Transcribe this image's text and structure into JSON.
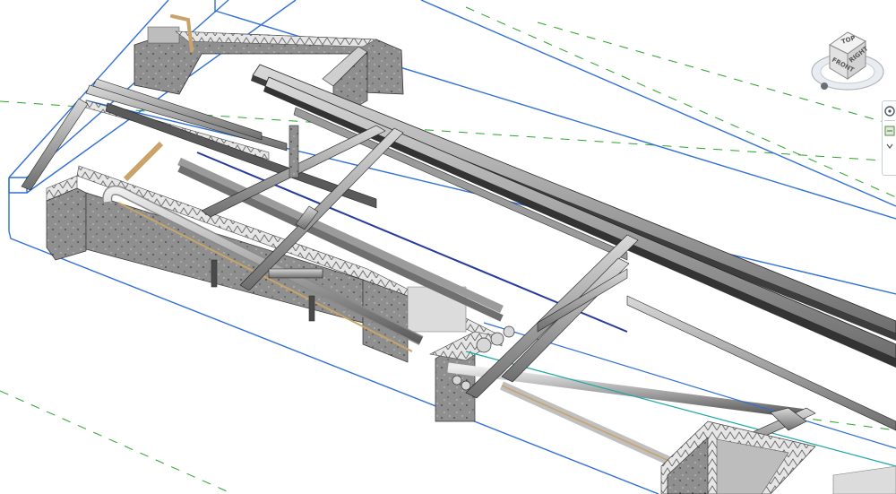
{
  "viewcube": {
    "top_label": "TOP",
    "front_label": "FRONT",
    "right_label": "RIGHT"
  },
  "colors": {
    "section_box": "#2f6fd6",
    "reference_plane": "#2aa52a",
    "concrete": "#7a7a7a",
    "pipe": "#b9b9b9",
    "pipe_insulated": "#c9a36a"
  },
  "icons": [
    "viewcube-icon",
    "home-icon",
    "steering-wheel-icon",
    "zoom-icon"
  ]
}
